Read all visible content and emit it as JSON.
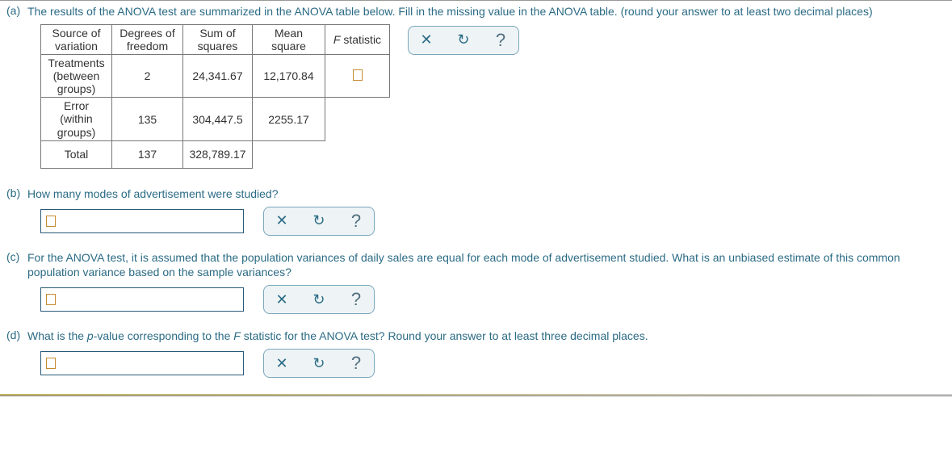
{
  "parts": {
    "a": {
      "letter": "(a)",
      "text": "The results of the ANOVA test are summarized in the ANOVA table below. Fill in the missing value in the ANOVA table. (round your answer to at least two decimal places)"
    },
    "b": {
      "letter": "(b)",
      "text": "How many modes of advertisement were studied?"
    },
    "c": {
      "letter": "(c)",
      "text": "For the ANOVA test, it is assumed that the population variances of daily sales are equal for each mode of advertisement studied. What is an unbiased estimate of this common population variance based on the sample variances?"
    },
    "d": {
      "letter": "(d)",
      "text_pre": "What is the ",
      "text_p": "p",
      "text_mid": "-value corresponding to the ",
      "text_F": "F",
      "text_post": " statistic for the ANOVA test? Round your answer to at least three decimal places."
    }
  },
  "table": {
    "headers": {
      "c1a": "Source of",
      "c1b": "variation",
      "c2a": "Degrees of",
      "c2b": "freedom",
      "c3a": "Sum of",
      "c3b": "squares",
      "c4": "Mean square",
      "c5a": "F",
      "c5b": " statistic"
    },
    "rows": {
      "treat": {
        "l1": "Treatments",
        "l2": "(between",
        "l3": "groups)",
        "df": "2",
        "ss": "24,341.67",
        "ms": "12,170.84"
      },
      "error": {
        "l1": "Error",
        "l2": "(within",
        "l3": "groups)",
        "df": "135",
        "ss": "304,447.5",
        "ms": "2255.17"
      },
      "total": {
        "l1": "Total",
        "df": "137",
        "ss": "328,789.17"
      }
    }
  },
  "icons": {
    "close": "✕",
    "reset": "↺",
    "help": "?"
  }
}
